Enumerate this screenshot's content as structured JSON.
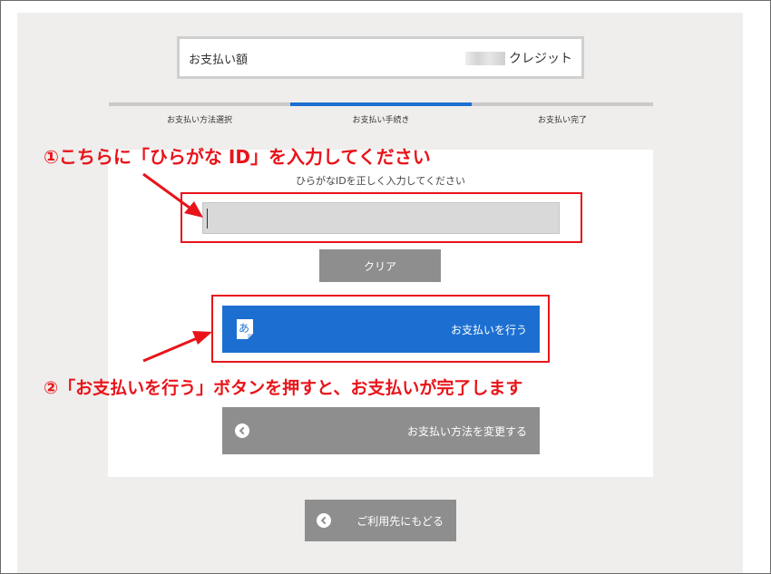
{
  "payment_summary": {
    "amount_label": "お支払い額",
    "amount_unit": "クレジット"
  },
  "steps": [
    {
      "label": "お支払い方法選択",
      "active": false
    },
    {
      "label": "お支払い手続き",
      "active": true
    },
    {
      "label": "お支払い完了",
      "active": false
    }
  ],
  "form": {
    "hint": "ひらがなIDを正しく入力してください",
    "input_value": "",
    "clear_label": "クリア",
    "pay_label": "お支払いを行う",
    "change_method_label": "お支払い方法を変更する"
  },
  "footer": {
    "back_label": "ご利用先にもどる"
  },
  "annotations": {
    "note1": "①こちらに「ひらがな ID」を入力してください",
    "note2": "②「お支払いを行う」ボタンを押すと、お支払いが完了します"
  },
  "colors": {
    "accent": "#1c6fd1",
    "annotation": "#e8141a",
    "button_gray": "#8e8e8e",
    "background": "#efeeec"
  },
  "icons": {
    "pay": "hiragana-note-icon",
    "change": "chevron-left-circle-icon",
    "back": "chevron-left-circle-icon"
  }
}
